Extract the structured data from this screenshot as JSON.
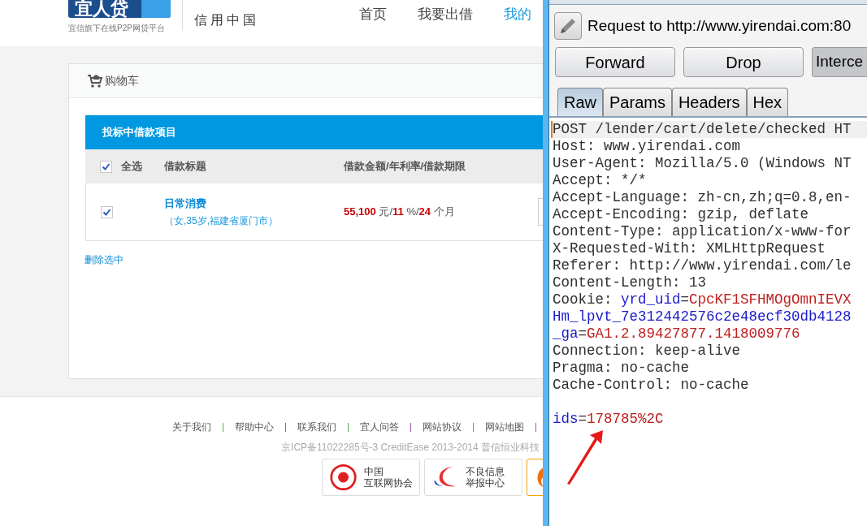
{
  "site": {
    "logo": "宜人贷",
    "tagline": "宜信旗下在线P2P网贷平台",
    "slogan": [
      "信用中国"
    ],
    "nav": [
      {
        "label": "首页",
        "selected": false
      },
      {
        "label": "我要出借",
        "selected": false
      },
      {
        "label": "我的",
        "selected": true
      }
    ]
  },
  "cart": {
    "title": "购物车",
    "section": "投标中借款项目",
    "select_all": {
      "label": "全选",
      "checked": true
    },
    "columns": [
      "借款标题",
      "借款金额/年利率/借款期限"
    ],
    "rows": [
      {
        "checked": true,
        "title": "日常消费",
        "subtitle": "（女,35岁,福建省厦门市）",
        "amount": "55,100",
        "amount_unit": "元/",
        "rate": "11",
        "rate_unit": "%/",
        "term": "24",
        "term_unit": "个月"
      }
    ],
    "delete_link": "删除选中"
  },
  "footer": {
    "links": [
      "关于我们",
      "帮助中心",
      "联系我们",
      "宜人问答",
      "网站协议",
      "网站地图"
    ],
    "copyright": "京ICP备11022285号-3 CreditEase 2013-2014 普信恒业科技",
    "badges": [
      {
        "kind": "seal",
        "lines": [
          "中国",
          "互联网协会"
        ]
      },
      {
        "kind": "swoosh",
        "lines": [
          "不良信息",
          "举报中心"
        ]
      },
      {
        "kind": "partial"
      }
    ]
  },
  "proxy": {
    "title": "Request to http://www.yirendai.com:80",
    "buttons": [
      {
        "label": "Forward",
        "pressed": false
      },
      {
        "label": "Drop",
        "pressed": false
      },
      {
        "label": "Interce",
        "pressed": true
      }
    ],
    "tabs": [
      {
        "label": "Raw",
        "selected": true
      },
      {
        "label": "Params",
        "selected": false
      },
      {
        "label": "Headers",
        "selected": false
      },
      {
        "label": "Hex",
        "selected": false
      }
    ],
    "lines": [
      [
        {
          "kind": "plain",
          "text": "POST /lender/cart/delete/checked HT"
        }
      ],
      [
        {
          "kind": "plain",
          "text": "Host: www.yirendai.com"
        }
      ],
      [
        {
          "kind": "plain",
          "text": "User-Agent: Mozilla/5.0 (Windows NT"
        }
      ],
      [
        {
          "kind": "plain",
          "text": "Accept: */*"
        }
      ],
      [
        {
          "kind": "plain",
          "text": "Accept-Language: zh-cn,zh;q=0.8,en-"
        }
      ],
      [
        {
          "kind": "plain",
          "text": "Accept-Encoding: gzip, deflate"
        }
      ],
      [
        {
          "kind": "plain",
          "text": "Content-Type: application/x-www-for"
        }
      ],
      [
        {
          "kind": "plain",
          "text": "X-Requested-With: XMLHttpRequest"
        }
      ],
      [
        {
          "kind": "plain",
          "text": "Referer: http://www.yirendai.com/le"
        }
      ],
      [
        {
          "kind": "plain",
          "text": "Content-Length: 13"
        }
      ],
      [
        {
          "kind": "plain",
          "text": "Cookie: "
        },
        {
          "kind": "name",
          "text": "yrd_uid"
        },
        {
          "kind": "plain",
          "text": "="
        },
        {
          "kind": "value",
          "text": "CpcKF1SFHMOgOmnIEVX"
        }
      ],
      [
        {
          "kind": "name",
          "text": "Hm_lpvt_7e312442576c2e48ecf30db4128"
        }
      ],
      [
        {
          "kind": "name",
          "text": "_ga"
        },
        {
          "kind": "plain",
          "text": "="
        },
        {
          "kind": "value",
          "text": "GA1.2.89427877.1418009776"
        }
      ],
      [
        {
          "kind": "plain",
          "text": "Connection: keep-alive"
        }
      ],
      [
        {
          "kind": "plain",
          "text": "Pragma: no-cache"
        }
      ],
      [
        {
          "kind": "plain",
          "text": "Cache-Control: no-cache"
        }
      ]
    ],
    "body": [
      {
        "kind": "name",
        "text": "ids"
      },
      {
        "kind": "plain",
        "text": "="
      },
      {
        "kind": "value",
        "text": "178785%2C"
      }
    ]
  }
}
